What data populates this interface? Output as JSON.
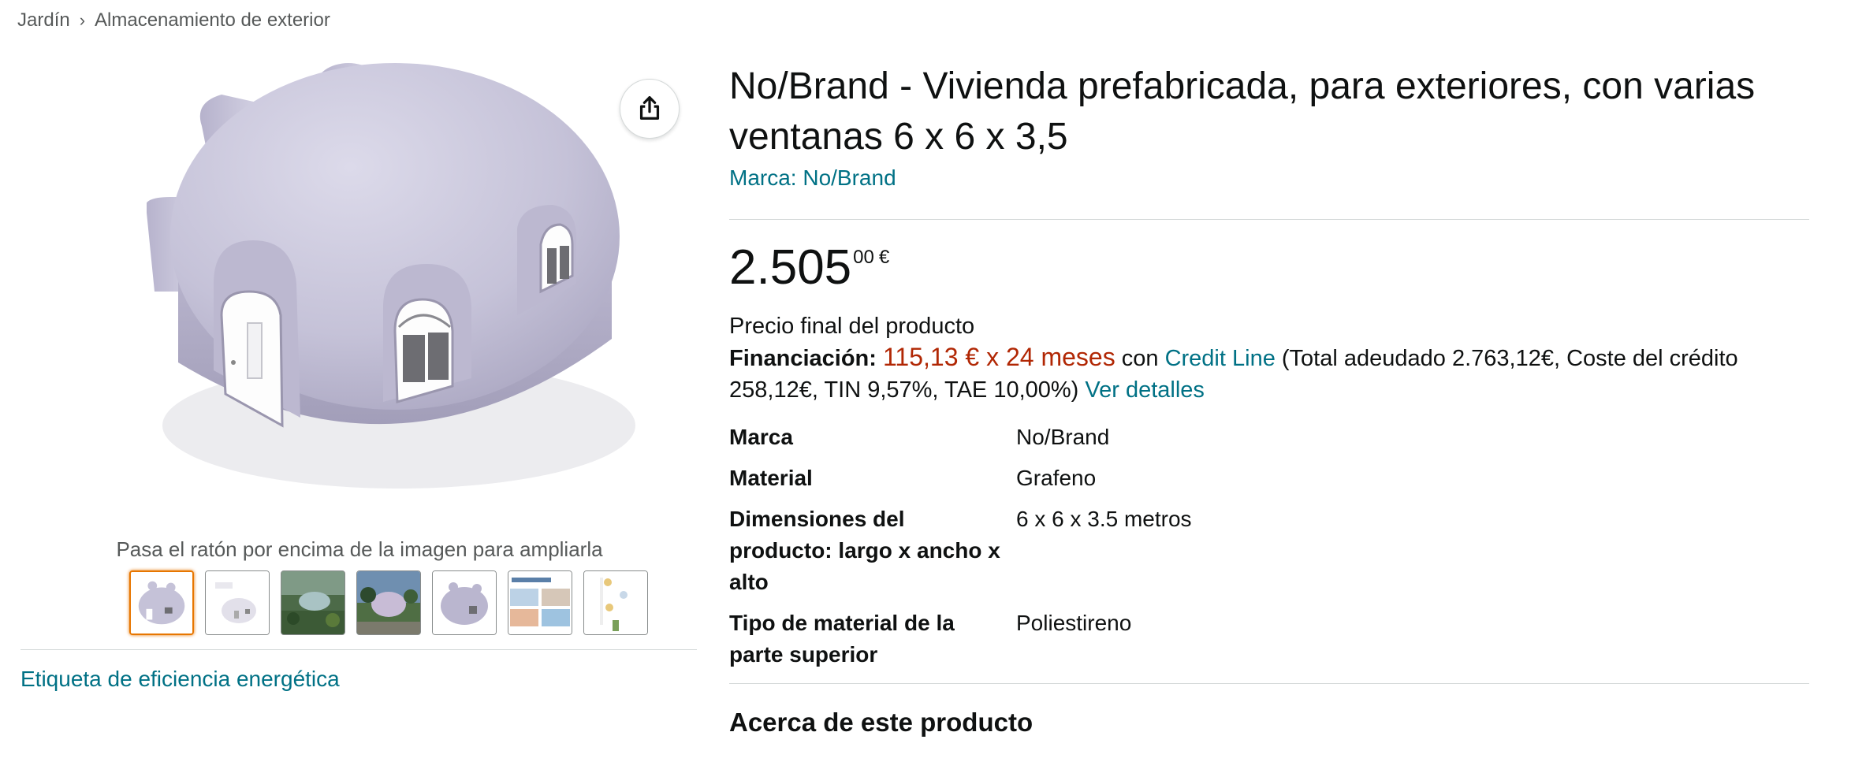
{
  "breadcrumb": {
    "items": [
      "Jardín",
      "Almacenamiento de exterior"
    ],
    "separator": "›"
  },
  "gallery": {
    "hover_hint": "Pasa el ratón por encima de la imagen para ampliarla",
    "thumbnail_count": 7,
    "selected_thumbnail": 0,
    "share_icon": "share-icon",
    "energy_label_link": "Etiqueta de eficiencia energética"
  },
  "product": {
    "title": "No/Brand - Vivienda prefabricada, para exteriores, con varias ventanas 6 x 6 x 3,5",
    "brand_link": "Marca: No/Brand",
    "price": {
      "whole": "2.505",
      "fraction": "00",
      "currency": "€"
    },
    "final_price_label": "Precio final del producto",
    "financing": {
      "label": "Financiación:",
      "amount": "115,13 € x 24 meses",
      "con": "con",
      "provider": "Credit Line",
      "terms": "(Total adeudado 2.763,12€, Coste del crédito 258,12€, TIN 9,57%, TAE 10,00%)",
      "details_link": "Ver detalles"
    },
    "specs": [
      {
        "key": "Marca",
        "value": "No/Brand"
      },
      {
        "key": "Material",
        "value": "Grafeno"
      },
      {
        "key": "Dimensiones del producto: largo x ancho x alto",
        "value": "6 x 6 x 3.5 metros"
      },
      {
        "key": "Tipo de material de la parte superior",
        "value": "Poliestireno"
      }
    ],
    "about_heading": "Acerca de este producto"
  },
  "colors": {
    "link": "#007185",
    "price_red": "#b12704",
    "selected_thumb": "#e77600",
    "dome": "#c9c6dc"
  }
}
